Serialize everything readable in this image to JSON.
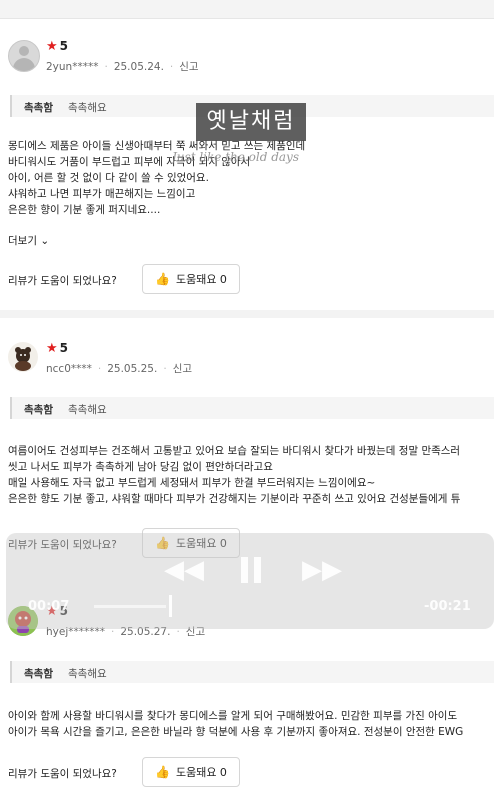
{
  "reviews": [
    {
      "rating": "5",
      "username": "2yun*****",
      "date": "25.05.24.",
      "report": "신고",
      "tag_key": "촉촉함",
      "tag_value": "촉촉해요",
      "lines": [
        "몽디에스 제품은 아이들 신생아때부터 쭉 써와서 믿고 쓰는 제품인데",
        "바디워시도 거품이 부드럽고 피부에 자극이 되지 않아서",
        "아이, 어른 할 것 없이 다 같이 쓸 수 있었어요.",
        "샤워하고 나면 피부가 매끈해지는 느낌이고",
        "은은한 향이 기분 좋게 퍼지네요...."
      ],
      "more": "더보기",
      "helpful_question": "리뷰가 도움이 되었나요?",
      "helpful_label": "도움돼요 0"
    },
    {
      "rating": "5",
      "username": "ncc0****",
      "date": "25.05.25.",
      "report": "신고",
      "tag_key": "촉촉함",
      "tag_value": "촉촉해요",
      "lines": [
        "여름이어도 건성피부는 건조해서 고통받고 있어요 보습 잘되는 바디워시 찾다가 바꿨는데 정말 만족스러",
        " 씻고 나서도 피부가 촉촉하게 남아 당김 없이 편안하더라고요",
        " 매일 사용해도 자극 없고 부드럽게 세정돼서 피부가 한결 부드러워지는 느낌이에요~",
        " 은은한 향도 기분 좋고, 샤워할 때마다 피부가 건강해지는 기분이라 꾸준히 쓰고 있어요 건성분들에게 튜"
      ],
      "helpful_question": "리뷰가 도움이 되었나요?",
      "helpful_label": "도움돼요 0"
    },
    {
      "rating": "5",
      "username": "hyej*******",
      "date": "25.05.27.",
      "report": "신고",
      "tag_key": "촉촉함",
      "tag_value": "촉촉해요",
      "lines": [
        "아이와 함께 사용할 바디워시를 찾다가 몽디에스를 알게 되어 구매해봤어요. 민감한 피부를 가진 아이도",
        "아이가 목욕 시간을 즐기고, 은은한 바닐라 향 덕분에 사용 후 기분까지 좋아져요. 전성분이 안전한 EWG"
      ],
      "helpful_question": "리뷰가 도움이 되었나요?",
      "helpful_label": "도움돼요 0"
    }
  ],
  "player": {
    "elapsed": "00:07",
    "remaining": "-00:21",
    "rewind_icon": "rewind-icon",
    "pause_icon": "pause-icon",
    "forward_icon": "fast-forward-icon",
    "progress": 0.25
  },
  "watermark": {
    "title": "옛날채럼",
    "subtitle": "Just like the old days"
  }
}
